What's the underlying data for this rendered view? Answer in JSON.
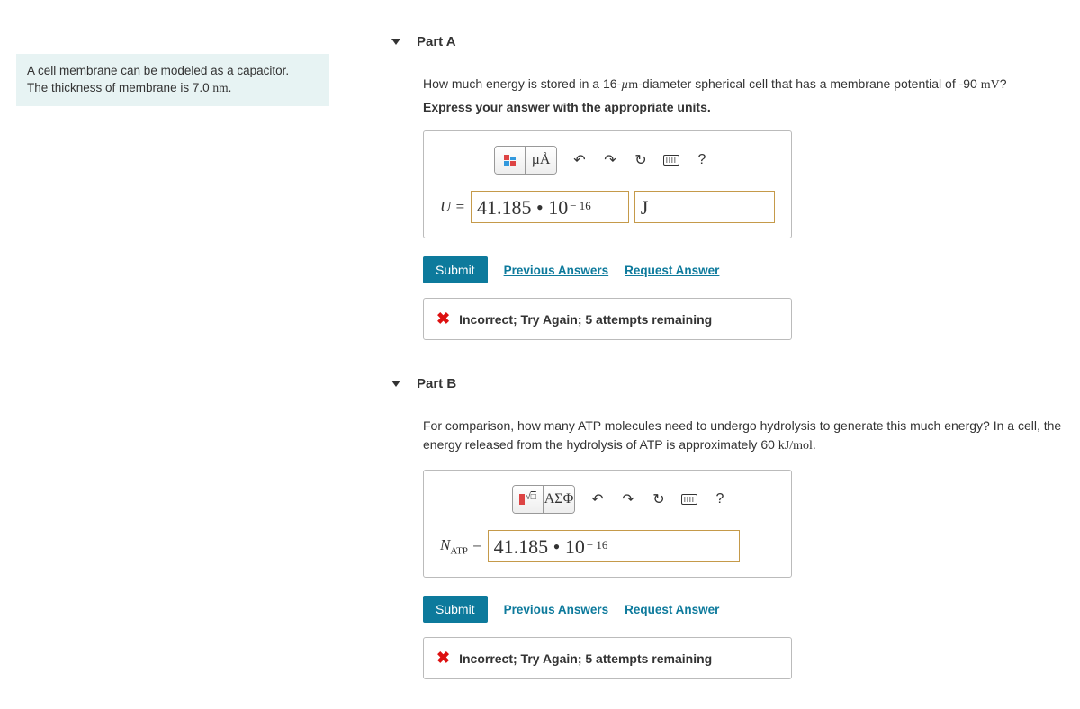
{
  "problem": {
    "line1": "A cell membrane can be modeled as a capacitor.",
    "line2": "The thickness of membrane is 7.0 nm."
  },
  "partA": {
    "title": "Part A",
    "question": "How much energy is stored in a 16-µm-diameter spherical cell that has a membrane potential of -90 mV?",
    "instructions": "Express your answer with the appropriate units.",
    "toolbar": {
      "units": "µÅ",
      "help": "?"
    },
    "var": "U =",
    "value": "41.185 • 10",
    "exp": "− 16",
    "unit": "J",
    "submit": "Submit",
    "prev": "Previous Answers",
    "request": "Request Answer",
    "feedback": "Incorrect; Try Again; 5 attempts remaining"
  },
  "partB": {
    "title": "Part B",
    "question": "For comparison, how many ATP molecules need to undergo hydrolysis to generate this much energy? In a cell, the energy released from the hydrolysis of ATP is approximately 60 kJ/mol.",
    "toolbar": {
      "symbols": "ΑΣΦ",
      "help": "?"
    },
    "var_base": "N",
    "var_sub": "ATP",
    "var_eq": " =",
    "value": "41.185 • 10",
    "exp": "− 16",
    "submit": "Submit",
    "prev": "Previous Answers",
    "request": "Request Answer",
    "feedback": "Incorrect; Try Again; 5 attempts remaining"
  }
}
